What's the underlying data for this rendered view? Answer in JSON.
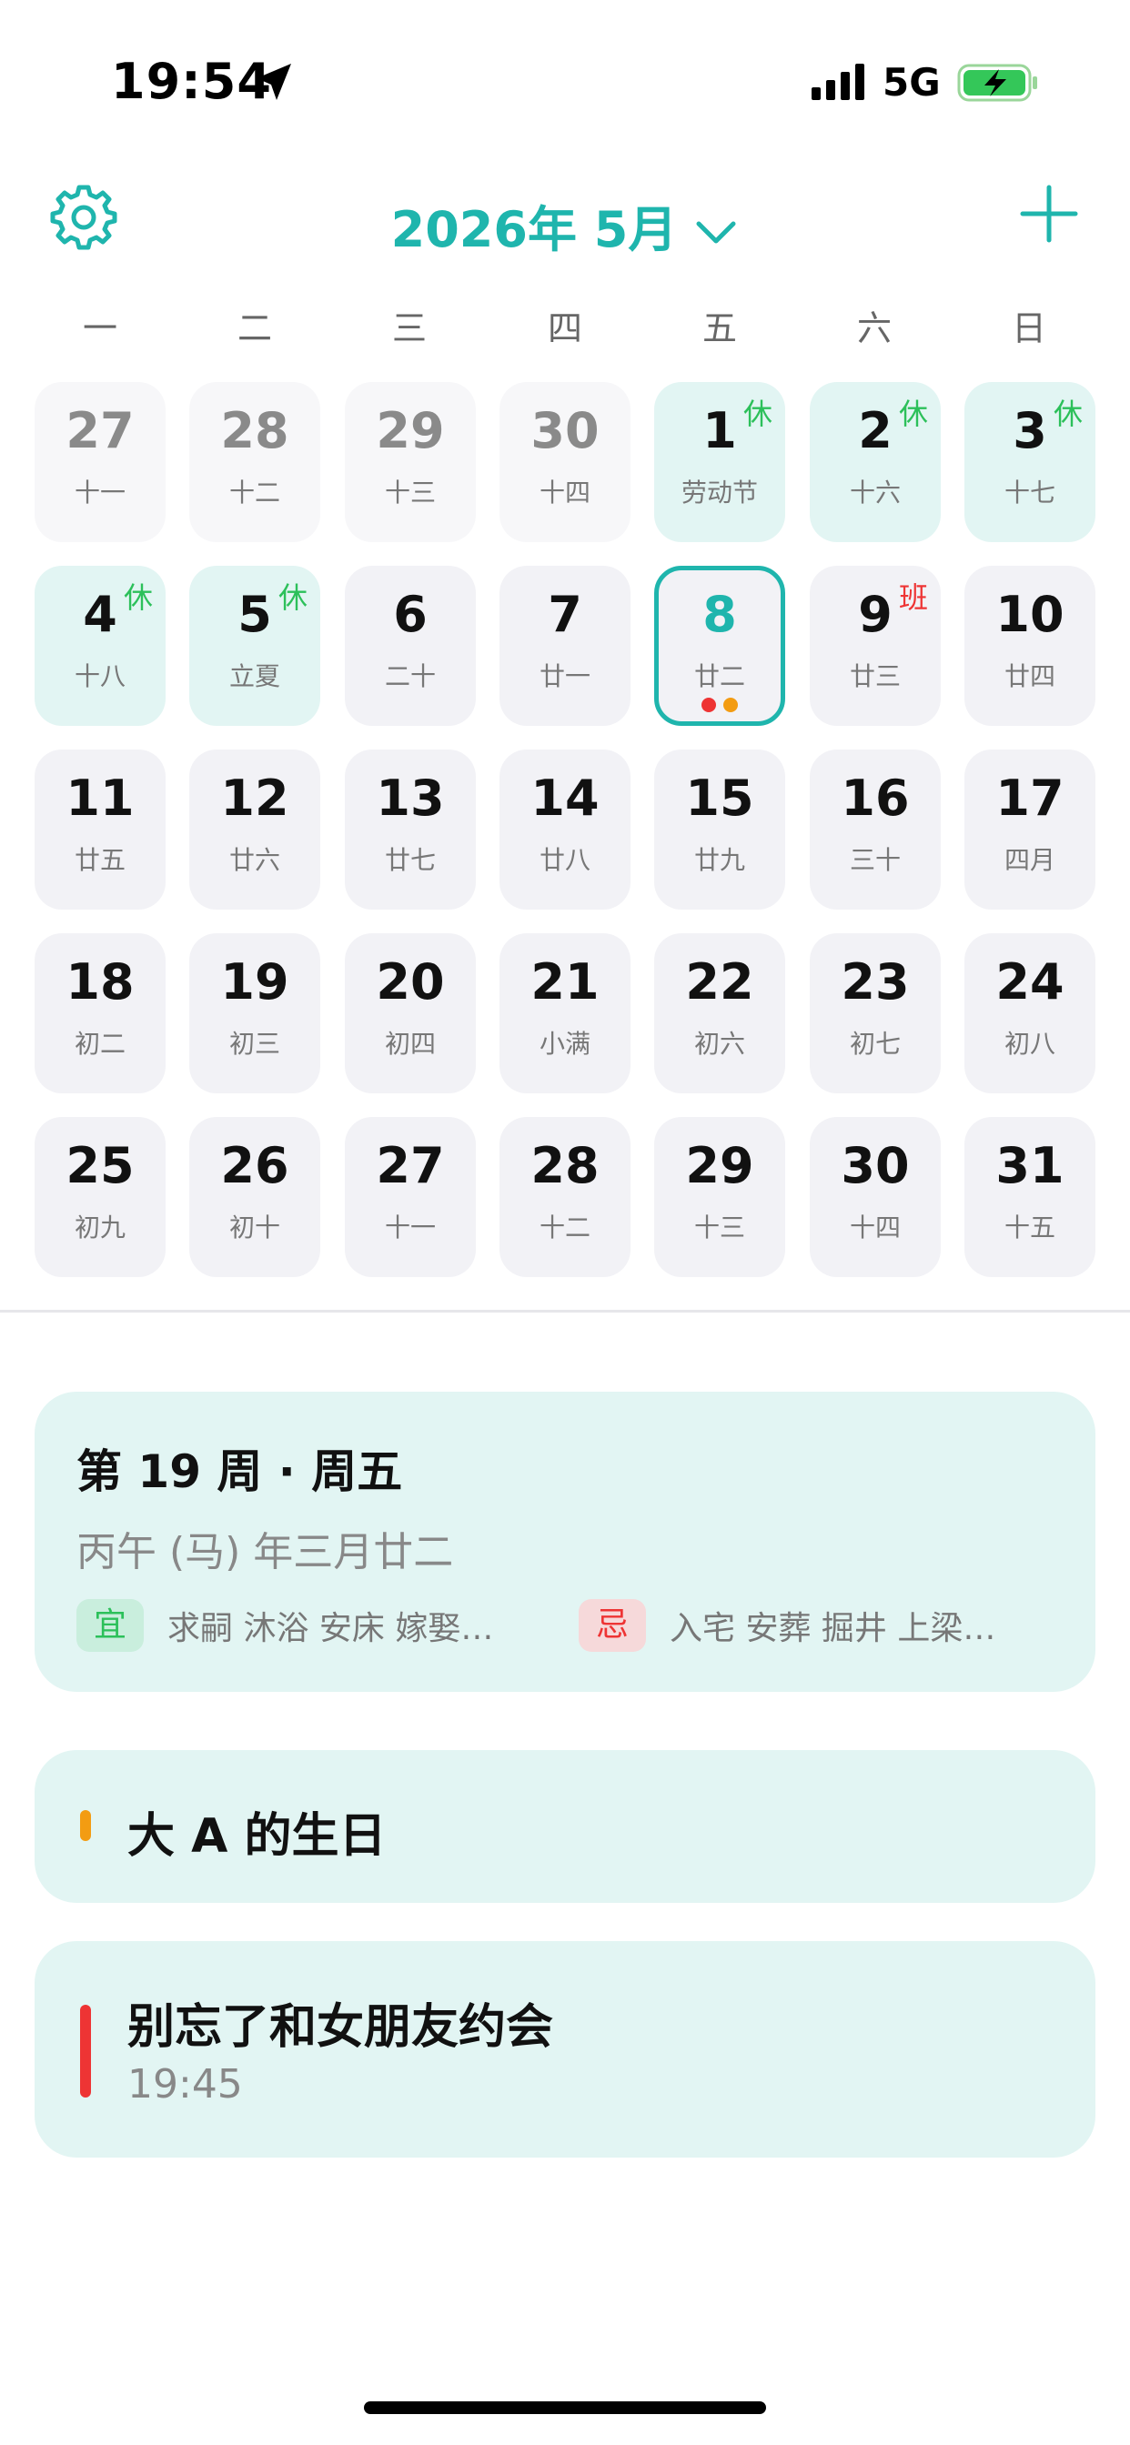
{
  "status_bar": {
    "time": "19:54",
    "network": "5G"
  },
  "header": {
    "month_title": "2026年 5月"
  },
  "weekdays": [
    "一",
    "二",
    "三",
    "四",
    "五",
    "六",
    "日"
  ],
  "calendar": {
    "weeks": [
      [
        {
          "day": "27",
          "lunar": "十一",
          "state": "prev"
        },
        {
          "day": "28",
          "lunar": "十二",
          "state": "prev"
        },
        {
          "day": "29",
          "lunar": "十三",
          "state": "prev"
        },
        {
          "day": "30",
          "lunar": "十四",
          "state": "prev"
        },
        {
          "day": "1",
          "lunar": "劳动节",
          "state": "holiday",
          "tag": "休"
        },
        {
          "day": "2",
          "lunar": "十六",
          "state": "holiday",
          "tag": "休"
        },
        {
          "day": "3",
          "lunar": "十七",
          "state": "holiday",
          "tag": "休"
        }
      ],
      [
        {
          "day": "4",
          "lunar": "十八",
          "state": "holiday",
          "tag": "休"
        },
        {
          "day": "5",
          "lunar": "立夏",
          "state": "holiday",
          "tag": "休"
        },
        {
          "day": "6",
          "lunar": "二十",
          "state": "normal"
        },
        {
          "day": "7",
          "lunar": "廿一",
          "state": "normal"
        },
        {
          "day": "8",
          "lunar": "廿二",
          "state": "today",
          "dots": [
            "#ee3434",
            "#f39c12"
          ]
        },
        {
          "day": "9",
          "lunar": "廿三",
          "state": "normal",
          "tag": "班",
          "tag_type": "work"
        },
        {
          "day": "10",
          "lunar": "廿四",
          "state": "normal"
        }
      ],
      [
        {
          "day": "11",
          "lunar": "廿五",
          "state": "normal"
        },
        {
          "day": "12",
          "lunar": "廿六",
          "state": "normal"
        },
        {
          "day": "13",
          "lunar": "廿七",
          "state": "normal"
        },
        {
          "day": "14",
          "lunar": "廿八",
          "state": "normal"
        },
        {
          "day": "15",
          "lunar": "廿九",
          "state": "normal"
        },
        {
          "day": "16",
          "lunar": "三十",
          "state": "normal"
        },
        {
          "day": "17",
          "lunar": "四月",
          "state": "normal"
        }
      ],
      [
        {
          "day": "18",
          "lunar": "初二",
          "state": "normal"
        },
        {
          "day": "19",
          "lunar": "初三",
          "state": "normal"
        },
        {
          "day": "20",
          "lunar": "初四",
          "state": "normal"
        },
        {
          "day": "21",
          "lunar": "小满",
          "state": "normal"
        },
        {
          "day": "22",
          "lunar": "初六",
          "state": "normal"
        },
        {
          "day": "23",
          "lunar": "初七",
          "state": "normal"
        },
        {
          "day": "24",
          "lunar": "初八",
          "state": "normal"
        }
      ],
      [
        {
          "day": "25",
          "lunar": "初九",
          "state": "normal"
        },
        {
          "day": "26",
          "lunar": "初十",
          "state": "normal"
        },
        {
          "day": "27",
          "lunar": "十一",
          "state": "normal"
        },
        {
          "day": "28",
          "lunar": "十二",
          "state": "normal"
        },
        {
          "day": "29",
          "lunar": "十三",
          "state": "normal"
        },
        {
          "day": "30",
          "lunar": "十四",
          "state": "normal"
        },
        {
          "day": "31",
          "lunar": "十五",
          "state": "normal"
        }
      ]
    ]
  },
  "info": {
    "week_label": "第 19 周 · 周五",
    "lunar_date": "丙午 (马) 年三月廿二",
    "yi_label": "宜",
    "yi_items": "求嗣 沐浴 安床 嫁娶…",
    "ji_label": "忌",
    "ji_items": "入宅 安葬 掘井 上梁…"
  },
  "events": [
    {
      "title": "大 A 的生日",
      "color": "#f39c12"
    },
    {
      "title": "别忘了和女朋友约会",
      "time": "19:45",
      "color": "#ee3434"
    }
  ],
  "colors": {
    "accent": "#1fb5ad",
    "rest": "#2cc05a",
    "work": "#ee3434"
  }
}
